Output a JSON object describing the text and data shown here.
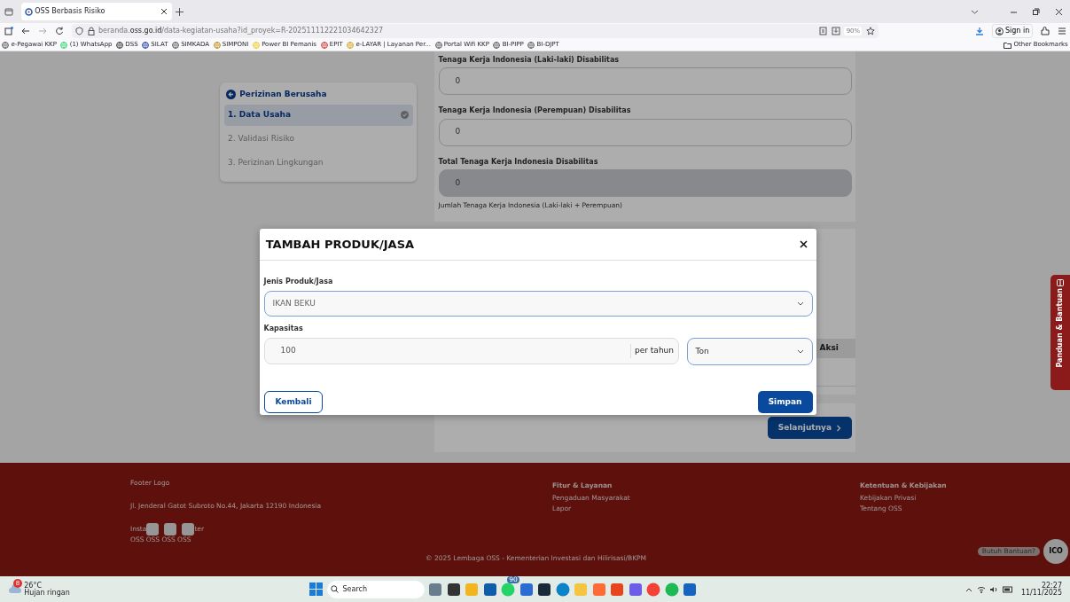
{
  "browser": {
    "tabs": [
      {
        "title": "OSS Berbasis Risiko",
        "selected": true
      }
    ],
    "url": {
      "prefix": "beranda.",
      "domain": "oss.go.id",
      "path": "/data-kegiatan-usaha?id_proyek=R-202511112221034642327"
    },
    "zoom": "90%",
    "sign_in": "Sign in",
    "bookmarks": [
      "e-Pegawai KKP",
      "(1) WhatsApp",
      "DSS",
      "SILAT",
      "SIMKADA",
      "SIMPONI",
      "Power BI Pemanis",
      "EPIT",
      "e-LAYAR | Layanan Per...",
      "Portal Wifi KKP",
      "BI-PIPP",
      "BI-DJPT"
    ],
    "other_bookmarks": "Other Bookmarks"
  },
  "sidebar": {
    "title": "Perizinan Berusaha",
    "steps": [
      {
        "label": "1. Data Usaha",
        "selected": true,
        "done": true
      },
      {
        "label": "2. Validasi Risiko",
        "selected": false,
        "done": false
      },
      {
        "label": "3. Perizinan Lingkungan",
        "selected": false,
        "done": false
      }
    ]
  },
  "form": {
    "fields": [
      {
        "label": "Tenaga Kerja Indonesia (Laki-laki) Disabilitas",
        "value": "0",
        "disabled": false
      },
      {
        "label": "Tenaga Kerja Indonesia (Perempuan) Disabilitas",
        "value": "0",
        "disabled": false
      },
      {
        "label": "Total Tenaga Kerja Indonesia Disabilitas",
        "value": "0",
        "disabled": true
      }
    ],
    "helper": "Jumlah Tenaga Kerja Indonesia (Laki-laki + Perempuan)"
  },
  "table": {
    "columns": [
      "Aksi"
    ]
  },
  "next_button": "Selanjutnya",
  "modal": {
    "title": "TAMBAH PRODUK/JASA",
    "product_label": "Jenis Produk/Jasa",
    "product_value": "IKAN BEKU",
    "capacity_label": "Kapasitas",
    "capacity_value": "100",
    "capacity_unit_addon": "per tahun",
    "unit_value": "Ton",
    "back_button": "Kembali",
    "save_button": "Simpan"
  },
  "footer": {
    "logo": "Footer Logo",
    "address": "Jl. Jenderal Gatot Subroto No.44, Jakarta 12190 Indonesia",
    "social_text_start": "Insta",
    "social_text_end": "ter",
    "social_labels": [
      "OSS",
      "OSS",
      "OSS",
      "OSS"
    ],
    "columns": [
      {
        "title": "Fitur & Layanan",
        "links": [
          "Pengaduan Masyarakat",
          "Lapor"
        ]
      },
      {
        "title": "Ketentuan & Kebijakan",
        "links": [
          "Kebijakan Privasi",
          "Tentang OSS"
        ]
      }
    ],
    "copyright": "© 2025 Lembaga OSS - Kementerian Investasi dan Hilirisasi/BKPM",
    "help_bubble": "Butuh Bantuan?",
    "help_circle": "ICO"
  },
  "help_tab": "Panduan & Bantuan",
  "taskbar": {
    "weather_badge": "8",
    "temperature": "26°C",
    "weather": "Hujan ringan",
    "search": "Search",
    "app_badge": "90",
    "time": "22:27",
    "date": "11/11/2025"
  }
}
